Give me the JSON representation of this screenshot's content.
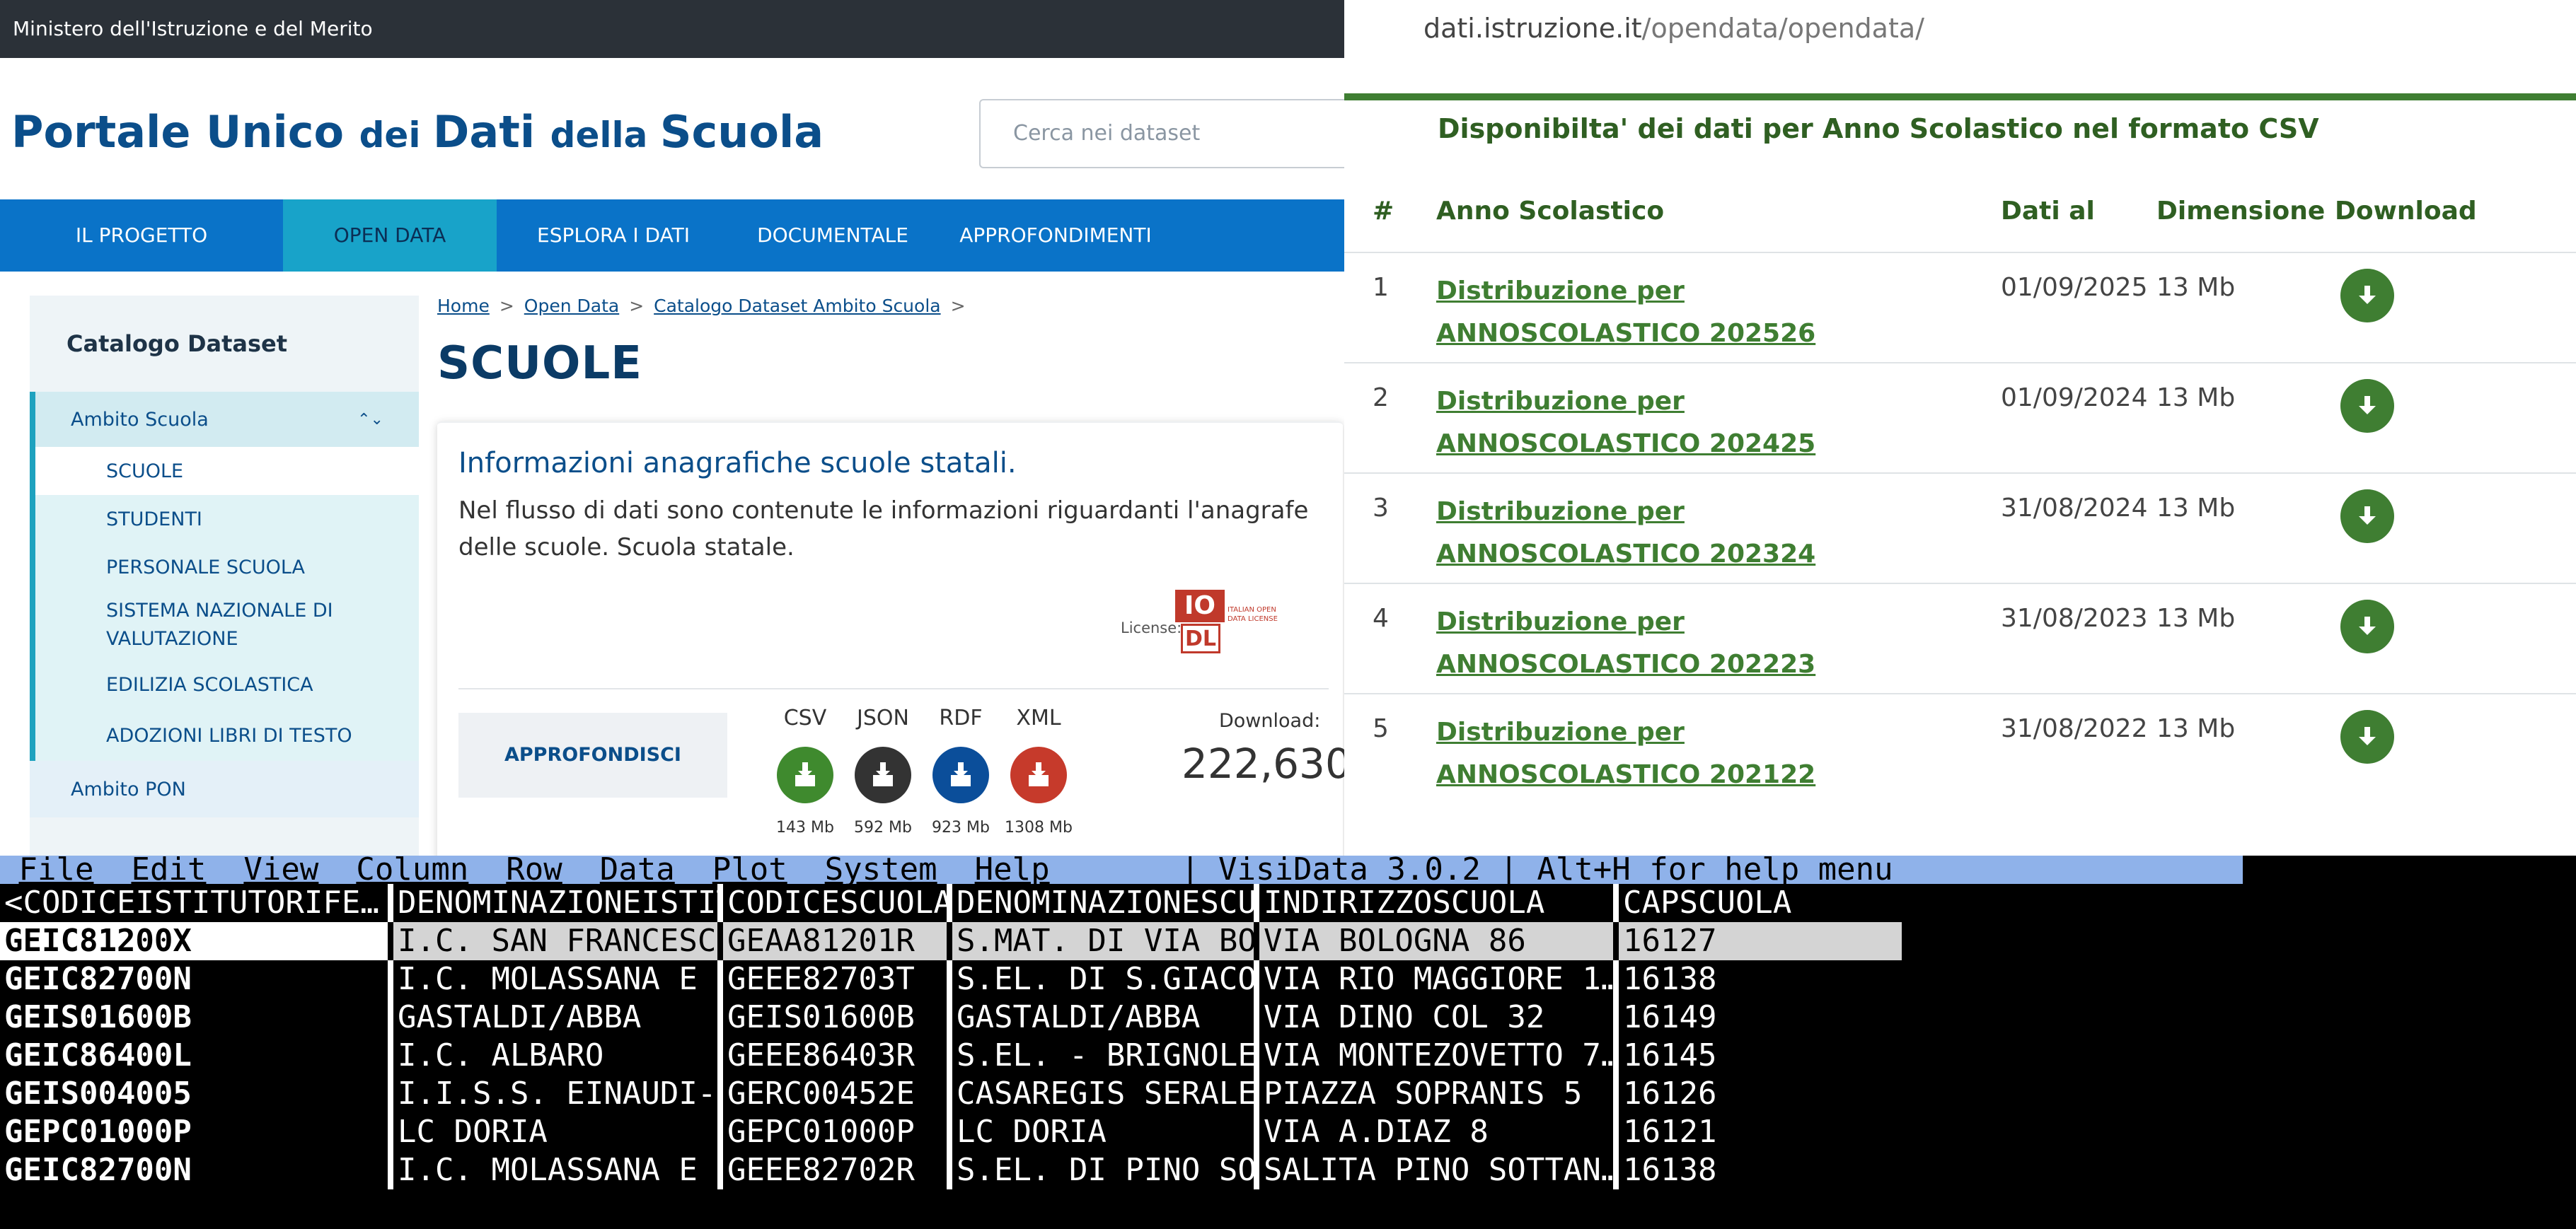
{
  "portal": {
    "gov_bar": "Ministero dell'Istruzione e del Merito",
    "title_1": "Portale Unico ",
    "title_2": "dei ",
    "title_3": "Dati ",
    "title_4": "della ",
    "title_5": "Scuola",
    "search_placeholder": "Cerca nei dataset",
    "nav": [
      "IL PROGETTO",
      "OPEN DATA",
      "ESPLORA I DATI",
      "DOCUMENTALE",
      "APPROFONDIMENTI"
    ],
    "sidebar": {
      "header": "Catalogo Dataset",
      "group": "Ambito Scuola",
      "items": [
        "SCUOLE",
        "STUDENTI",
        "PERSONALE SCUOLA",
        "SISTEMA NAZIONALE DI VALUTAZIONE",
        "EDILIZIA SCOLASTICA",
        "ADOZIONI LIBRI DI TESTO"
      ],
      "pon": "Ambito PON"
    },
    "breadcrumb": [
      "Home",
      "Open Data",
      "Catalogo Dataset Ambito Scuola"
    ],
    "page_title": "SCUOLE",
    "card": {
      "heading": "Informazioni anagrafiche scuole statali.",
      "description": "Nel flusso di dati sono contenute le informazioni riguardanti l'anagrafe delle scuole. Scuola statale.",
      "license_label": "License:",
      "license_badge_top": "IO",
      "license_badge_bottom": "DL",
      "license_badge_text": "ITALIAN OPEN DATA LICENSE",
      "approfondisci": "APPROFONDISCI",
      "formats": [
        {
          "label": "CSV",
          "size": "143 Mb",
          "color": "#3f8a2e"
        },
        {
          "label": "JSON",
          "size": "592 Mb",
          "color": "#333333"
        },
        {
          "label": "RDF",
          "size": "923 Mb",
          "color": "#0b4e9a"
        },
        {
          "label": "XML",
          "size": "1308 Mb",
          "color": "#c63a2b"
        }
      ],
      "download_label": "Download:",
      "download_count": "222,630"
    }
  },
  "csv_panel": {
    "url_host": "dati.istruzione.it",
    "url_path": "/opendata/opendata/",
    "title": "Disponibilta' dei dati per Anno Scolastico nel formato CSV",
    "headers": [
      "#",
      "Anno Scolastico",
      "Dati al",
      "Dimensione",
      "Download"
    ],
    "rows": [
      {
        "num": "1",
        "name": "Distribuzione per ANNOSCOLASTICO 202526",
        "date": "01/09/2025",
        "size": "13 Mb"
      },
      {
        "num": "2",
        "name": "Distribuzione per ANNOSCOLASTICO 202425",
        "date": "01/09/2024",
        "size": "13 Mb"
      },
      {
        "num": "3",
        "name": "Distribuzione per ANNOSCOLASTICO 202324",
        "date": "31/08/2024",
        "size": "13 Mb"
      },
      {
        "num": "4",
        "name": "Distribuzione per ANNOSCOLASTICO 202223",
        "date": "31/08/2023",
        "size": "13 Mb"
      },
      {
        "num": "5",
        "name": "Distribuzione per ANNOSCOLASTICO 202122",
        "date": "31/08/2022",
        "size": "13 Mb"
      }
    ],
    "download_icon": "download-icon",
    "accent_color": "#3f7e32"
  },
  "visidata": {
    "menu": [
      "File",
      "Edit",
      "View",
      "Column",
      "Row",
      "Data",
      "Plot",
      "System",
      "Help"
    ],
    "status": "| VisiData 3.0.2 | Alt+H for help menu",
    "columns": [
      "<CODICEISTITUTORIFE…",
      "DENOMINAZIONEISTIT…",
      "CODICESCUOLA",
      "DENOMINAZIONESCUOLA",
      "INDIRIZZOSCUOLA",
      "CAPSCUOLA"
    ],
    "rows": [
      [
        "GEIC81200X",
        "I.C. SAN FRANCESCO…",
        "GEAA81201R",
        "S.MAT. DI VIA BOLO…",
        "VIA BOLOGNA 86",
        "16127"
      ],
      [
        "GEIC82700N",
        "I.C. MOLASSANA E P…",
        "GEEE82703T",
        "S.EL. DI S.GIACOMO",
        "VIA RIO MAGGIORE 1…",
        "16138"
      ],
      [
        "GEIS01600B",
        "GASTALDI/ABBA",
        "GEIS01600B",
        "GASTALDI/ABBA",
        "VIA DINO COL 32",
        "16149"
      ],
      [
        "GEIC86400L",
        "I.C. ALBARO",
        "GEEE86403R",
        "S.EL. - BRIGNOLE S…",
        "VIA MONTEZOVETTO 7…",
        "16145"
      ],
      [
        "GEIS004005",
        "I.I.S.S. EINAUDI-C…",
        "GERC00452E",
        "CASAREGIS SERALE",
        "PIAZZA SOPRANIS 5",
        "16126"
      ],
      [
        "GEPC01000P",
        "LC DORIA",
        "GEPC01000P",
        "LC DORIA",
        "VIA A.DIAZ 8",
        "16121"
      ],
      [
        "GEIC82700N",
        "I.C. MOLASSANA E P…",
        "GEEE82702R",
        "S.EL. DI PINO SOPR…",
        "SALITA PINO SOTTAN…",
        "16138"
      ]
    ],
    "selected_row": 0
  }
}
